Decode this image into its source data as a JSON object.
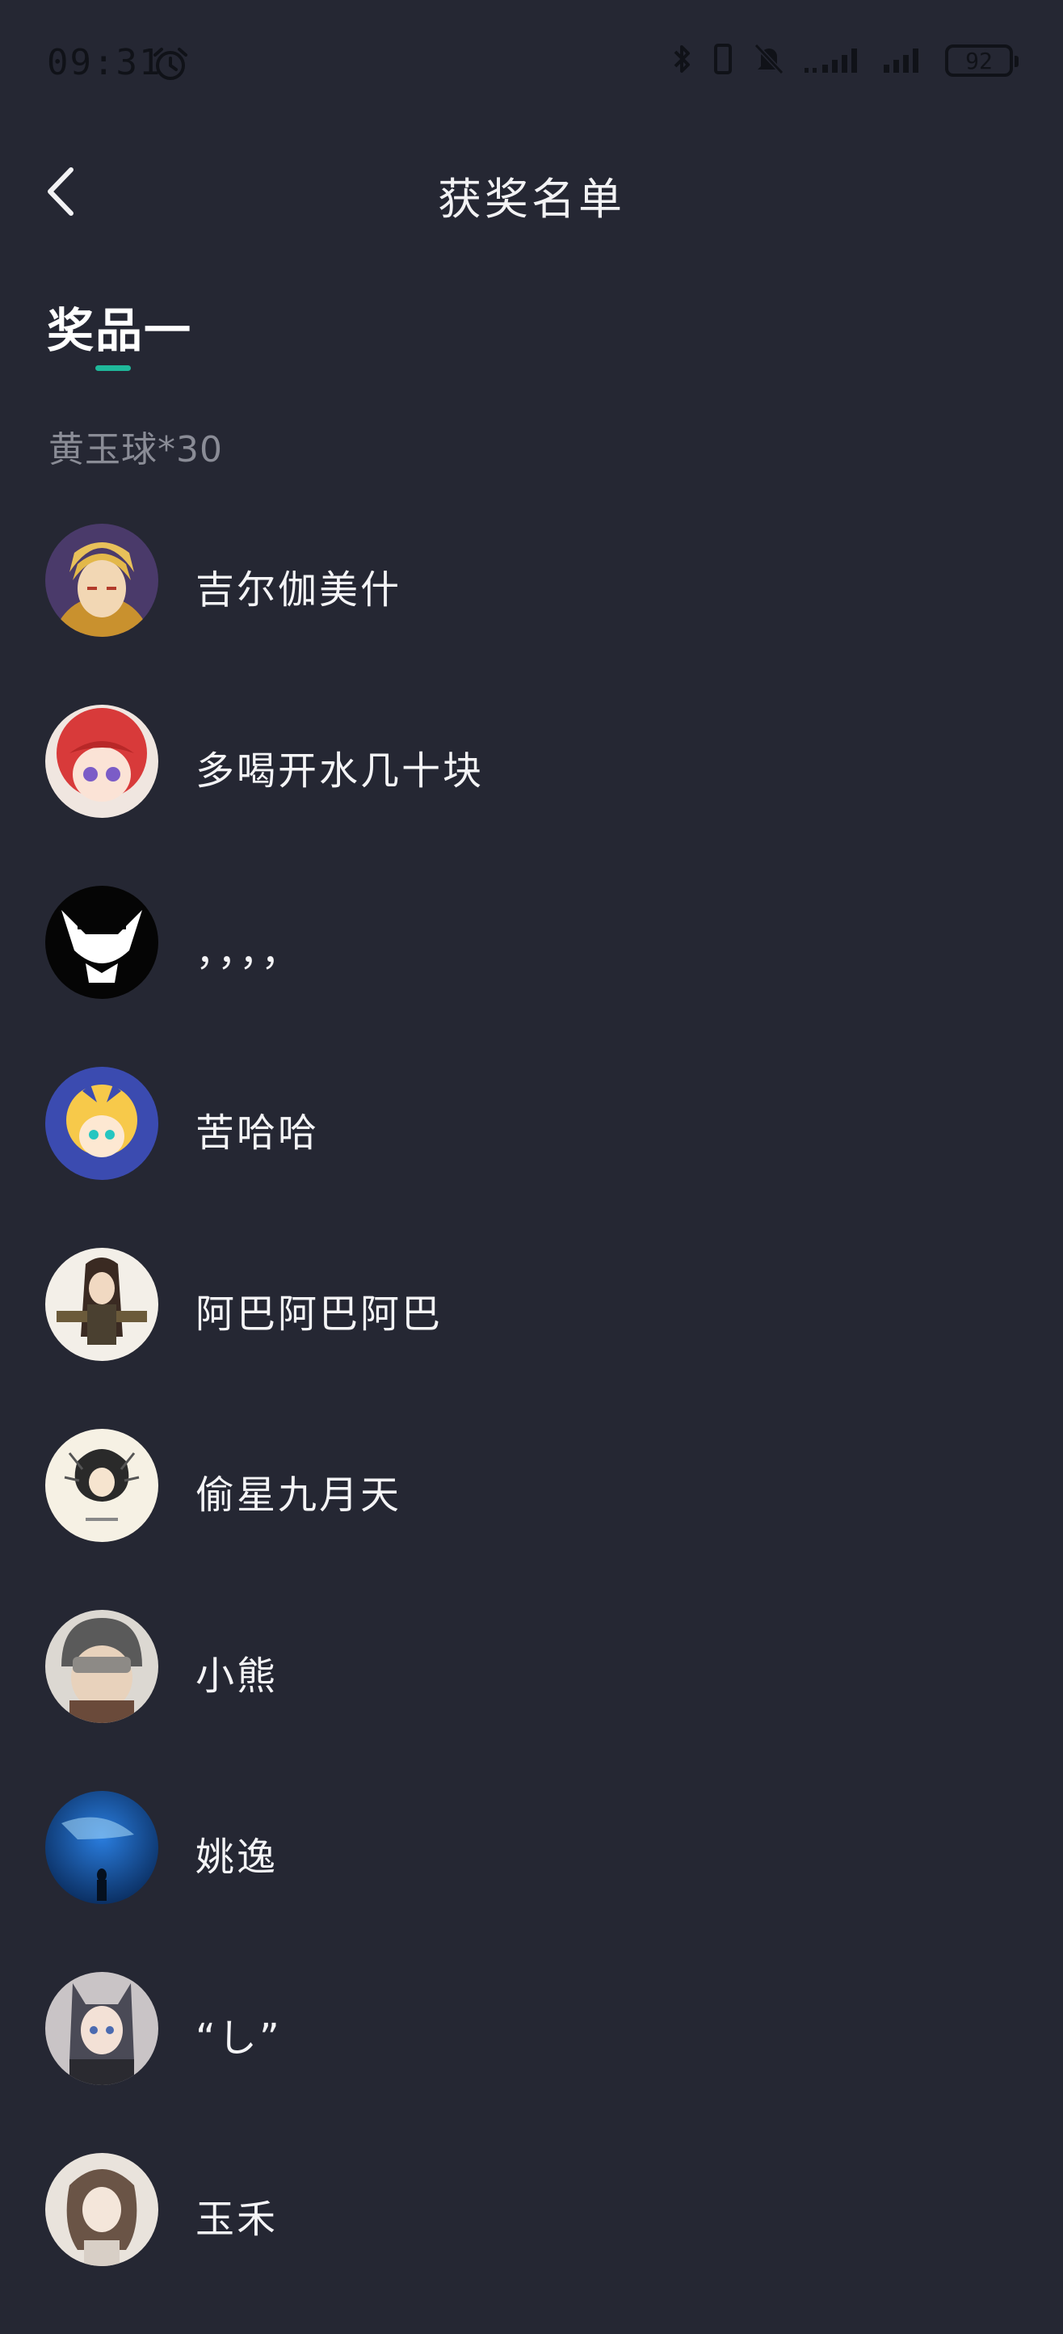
{
  "status_bar": {
    "time": "09:31",
    "battery": "92",
    "icons": [
      "alarm-icon",
      "bluetooth-icon",
      "vibrate-icon",
      "mute-icon",
      "signal-icon",
      "signal-icon"
    ]
  },
  "nav": {
    "title": "获奖名单",
    "back_icon": "chevron-left-icon"
  },
  "prize": {
    "tab_label": "奖品一",
    "description": "黄玉球*30",
    "accent_color": "#1fb89a"
  },
  "winners": [
    {
      "name": "吉尔伽美什"
    },
    {
      "name": "多喝开水几十块"
    },
    {
      "name": "，，，，"
    },
    {
      "name": "苦哈哈"
    },
    {
      "name": "阿巴阿巴阿巴"
    },
    {
      "name": "偷星九月天"
    },
    {
      "name": "小熊"
    },
    {
      "name": "姚逸"
    },
    {
      "name": "“し”"
    },
    {
      "name": "玉禾"
    }
  ]
}
